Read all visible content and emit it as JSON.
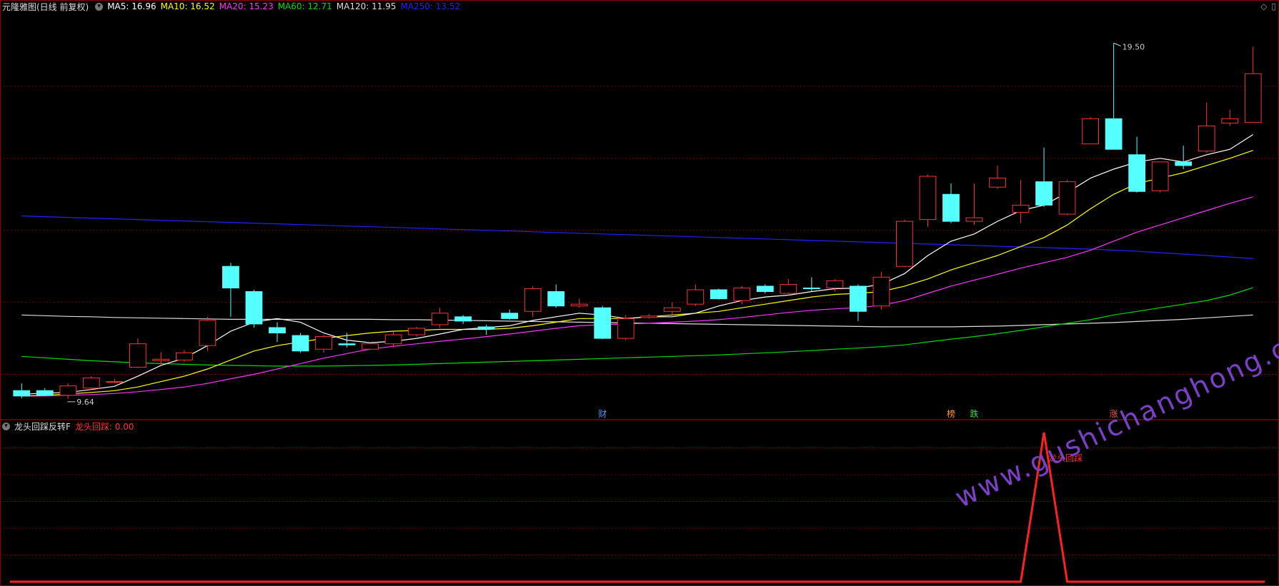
{
  "header": {
    "title": "元隆雅图(日线 前复权)",
    "ma": [
      {
        "label": "MA5: 16.96",
        "color": "#ffffff"
      },
      {
        "label": "MA10: 16.52",
        "color": "#ffff00"
      },
      {
        "label": "MA20: 15.23",
        "color": "#ff33ff"
      },
      {
        "label": "MA60: 12.71",
        "color": "#00dd00"
      },
      {
        "label": "MA120: 11.95",
        "color": "#dddddd"
      },
      {
        "label": "MA250: 13.52",
        "color": "#2222ff"
      }
    ]
  },
  "indicator": {
    "name": "龙头回踩反转F",
    "value_label": "龙头回踩: 0.00",
    "signal_label": "龙头回踩"
  },
  "markers": {
    "high": "19.50",
    "low": "9.64",
    "events": [
      {
        "text": "财",
        "color": "#5599ff",
        "idx": 25
      },
      {
        "text": "榜",
        "color": "#ff9933",
        "idx": 40
      },
      {
        "text": "跌",
        "color": "#33dd33",
        "idx": 41
      },
      {
        "text": "涨",
        "color": "#ff5555",
        "idx": 47
      }
    ]
  },
  "watermark": "www.gushichanghong.com",
  "colors": {
    "up": "#ff3232",
    "down": "#54ffff",
    "grid": "#7a0000",
    "bg": "#000000"
  },
  "chart_data": {
    "type": "candlestick",
    "ylim": [
      9.3,
      20.3
    ],
    "candles": [
      [
        9.85,
        9.7,
        10.05,
        9.64
      ],
      [
        9.85,
        9.72,
        9.92,
        9.7
      ],
      [
        9.72,
        9.98,
        10.05,
        9.62
      ],
      [
        9.92,
        10.2,
        10.25,
        9.88
      ],
      [
        10.1,
        10.1,
        10.18,
        10.05
      ],
      [
        10.5,
        11.15,
        11.3,
        10.48
      ],
      [
        10.68,
        10.72,
        10.92,
        10.55
      ],
      [
        10.7,
        10.9,
        10.98,
        10.65
      ],
      [
        11.1,
        11.8,
        11.9,
        10.95
      ],
      [
        13.3,
        12.7,
        13.4,
        11.9
      ],
      [
        12.6,
        11.7,
        12.65,
        11.6
      ],
      [
        11.6,
        11.45,
        11.75,
        11.2
      ],
      [
        11.38,
        10.95,
        11.45,
        10.9
      ],
      [
        11.0,
        11.35,
        11.4,
        10.9
      ],
      [
        11.15,
        11.12,
        11.45,
        11.05
      ],
      [
        11.0,
        11.15,
        11.2,
        10.98
      ],
      [
        11.15,
        11.4,
        11.48,
        11.05
      ],
      [
        11.4,
        11.58,
        11.62,
        11.35
      ],
      [
        11.68,
        12.0,
        12.15,
        11.6
      ],
      [
        11.9,
        11.78,
        11.95,
        11.7
      ],
      [
        11.62,
        11.57,
        11.68,
        11.4
      ],
      [
        12.0,
        11.85,
        12.1,
        11.82
      ],
      [
        12.05,
        12.68,
        12.75,
        11.9
      ],
      [
        12.6,
        12.2,
        12.8,
        12.15
      ],
      [
        12.2,
        12.25,
        12.4,
        12.15
      ],
      [
        12.15,
        11.3,
        12.2,
        11.28
      ],
      [
        11.3,
        11.85,
        11.95,
        11.25
      ],
      [
        11.88,
        11.92,
        11.98,
        11.85
      ],
      [
        12.05,
        12.15,
        12.3,
        11.95
      ],
      [
        12.25,
        12.65,
        12.8,
        12.2
      ],
      [
        12.65,
        12.4,
        12.68,
        12.38
      ],
      [
        12.35,
        12.7,
        12.75,
        12.25
      ],
      [
        12.75,
        12.6,
        12.8,
        12.55
      ],
      [
        12.55,
        12.8,
        12.95,
        12.5
      ],
      [
        12.7,
        12.68,
        13.0,
        12.6
      ],
      [
        12.7,
        12.9,
        12.95,
        12.6
      ],
      [
        12.75,
        12.05,
        12.8,
        11.78
      ],
      [
        12.2,
        13.0,
        13.15,
        12.1
      ],
      [
        13.3,
        14.55,
        14.6,
        13.28
      ],
      [
        14.6,
        15.8,
        15.85,
        14.4
      ],
      [
        15.3,
        14.55,
        15.6,
        14.5
      ],
      [
        14.55,
        14.65,
        15.6,
        14.45
      ],
      [
        15.5,
        15.75,
        16.1,
        15.45
      ],
      [
        14.8,
        15.0,
        15.7,
        14.5
      ],
      [
        15.65,
        15.0,
        16.6,
        14.95
      ],
      [
        14.75,
        15.65,
        15.7,
        14.72
      ],
      [
        16.7,
        17.4,
        17.45,
        16.7
      ],
      [
        17.4,
        16.55,
        19.5,
        16.55
      ],
      [
        16.4,
        15.38,
        16.9,
        15.35
      ],
      [
        15.4,
        16.2,
        16.2,
        15.35
      ],
      [
        16.2,
        16.1,
        16.65,
        16.0
      ],
      [
        16.5,
        17.2,
        17.85,
        16.45
      ],
      [
        17.28,
        17.4,
        17.65,
        17.2
      ],
      [
        17.3,
        18.65,
        19.4,
        17.3
      ]
    ],
    "ma5": [
      9.75,
      9.78,
      9.8,
      9.88,
      9.97,
      10.25,
      10.55,
      10.75,
      11.1,
      11.5,
      11.75,
      11.85,
      11.75,
      11.45,
      11.25,
      11.18,
      11.22,
      11.3,
      11.42,
      11.55,
      11.6,
      11.65,
      11.8,
      11.9,
      12.0,
      11.95,
      11.85,
      11.9,
      11.9,
      12.0,
      12.2,
      12.35,
      12.45,
      12.5,
      12.6,
      12.68,
      12.7,
      12.8,
      13.1,
      13.6,
      14.0,
      14.2,
      14.55,
      14.85,
      15.0,
      15.35,
      15.75,
      16.0,
      16.2,
      16.3,
      16.2,
      16.4,
      16.55,
      16.96
    ],
    "ma10": [
      9.7,
      9.72,
      9.76,
      9.8,
      9.85,
      9.95,
      10.1,
      10.25,
      10.45,
      10.7,
      10.95,
      11.1,
      11.2,
      11.3,
      11.38,
      11.45,
      11.5,
      11.52,
      11.55,
      11.55,
      11.55,
      11.58,
      11.65,
      11.75,
      11.85,
      11.85,
      11.85,
      11.9,
      11.95,
      12.0,
      12.05,
      12.15,
      12.25,
      12.35,
      12.45,
      12.52,
      12.55,
      12.6,
      12.75,
      12.95,
      13.2,
      13.4,
      13.6,
      13.85,
      14.1,
      14.45,
      14.9,
      15.3,
      15.6,
      15.75,
      15.9,
      16.1,
      16.3,
      16.52
    ],
    "ma20": [
      9.7,
      9.7,
      9.72,
      9.74,
      9.77,
      9.82,
      9.88,
      9.95,
      10.05,
      10.18,
      10.3,
      10.45,
      10.6,
      10.75,
      10.88,
      11.0,
      11.08,
      11.15,
      11.22,
      11.28,
      11.35,
      11.42,
      11.5,
      11.58,
      11.65,
      11.68,
      11.7,
      11.72,
      11.75,
      11.78,
      11.82,
      11.88,
      11.95,
      12.02,
      12.08,
      12.12,
      12.15,
      12.22,
      12.35,
      12.55,
      12.75,
      12.92,
      13.08,
      13.25,
      13.4,
      13.55,
      13.75,
      14.0,
      14.25,
      14.45,
      14.65,
      14.85,
      15.05,
      15.23
    ],
    "ma60": [
      10.8,
      10.76,
      10.72,
      10.68,
      10.65,
      10.62,
      10.6,
      10.58,
      10.56,
      10.55,
      10.54,
      10.53,
      10.53,
      10.53,
      10.54,
      10.55,
      10.56,
      10.58,
      10.6,
      10.62,
      10.64,
      10.66,
      10.68,
      10.7,
      10.72,
      10.74,
      10.76,
      10.78,
      10.8,
      10.82,
      10.84,
      10.87,
      10.9,
      10.93,
      10.96,
      11.0,
      11.03,
      11.07,
      11.12,
      11.2,
      11.28,
      11.35,
      11.43,
      11.52,
      11.62,
      11.72,
      11.82,
      11.95,
      12.05,
      12.15,
      12.25,
      12.35,
      12.5,
      12.71
    ],
    "ma120": [
      11.95,
      11.93,
      11.91,
      11.9,
      11.88,
      11.87,
      11.86,
      11.85,
      11.84,
      11.83,
      11.83,
      11.83,
      11.83,
      11.83,
      11.83,
      11.83,
      11.82,
      11.82,
      11.81,
      11.8,
      11.79,
      11.78,
      11.77,
      11.76,
      11.75,
      11.74,
      11.73,
      11.72,
      11.71,
      11.7,
      11.69,
      11.68,
      11.67,
      11.66,
      11.65,
      11.64,
      11.63,
      11.62,
      11.62,
      11.62,
      11.62,
      11.63,
      11.64,
      11.66,
      11.68,
      11.7,
      11.72,
      11.74,
      11.77,
      11.8,
      11.83,
      11.87,
      11.91,
      11.95
    ],
    "ma250": [
      14.7,
      14.68,
      14.66,
      14.64,
      14.62,
      14.6,
      14.58,
      14.56,
      14.54,
      14.52,
      14.5,
      14.48,
      14.46,
      14.44,
      14.42,
      14.4,
      14.38,
      14.36,
      14.34,
      14.32,
      14.3,
      14.28,
      14.26,
      14.24,
      14.22,
      14.2,
      14.18,
      14.16,
      14.14,
      14.12,
      14.1,
      14.08,
      14.06,
      14.04,
      14.02,
      14.0,
      13.98,
      13.96,
      13.94,
      13.92,
      13.9,
      13.88,
      13.86,
      13.84,
      13.82,
      13.8,
      13.78,
      13.75,
      13.72,
      13.68,
      13.64,
      13.6,
      13.56,
      13.52
    ],
    "indicator": {
      "ylim": [
        0,
        1.0
      ],
      "values": [
        0,
        0,
        0,
        0,
        0,
        0,
        0,
        0,
        0,
        0,
        0,
        0,
        0,
        0,
        0,
        0,
        0,
        0,
        0,
        0,
        0,
        0,
        0,
        0,
        0,
        0,
        0,
        0,
        0,
        0,
        0,
        0,
        0,
        0,
        0,
        0,
        0,
        0,
        0,
        0,
        0,
        0,
        0,
        0,
        1,
        0,
        0,
        0,
        0,
        0,
        0,
        0,
        0,
        0
      ]
    }
  }
}
